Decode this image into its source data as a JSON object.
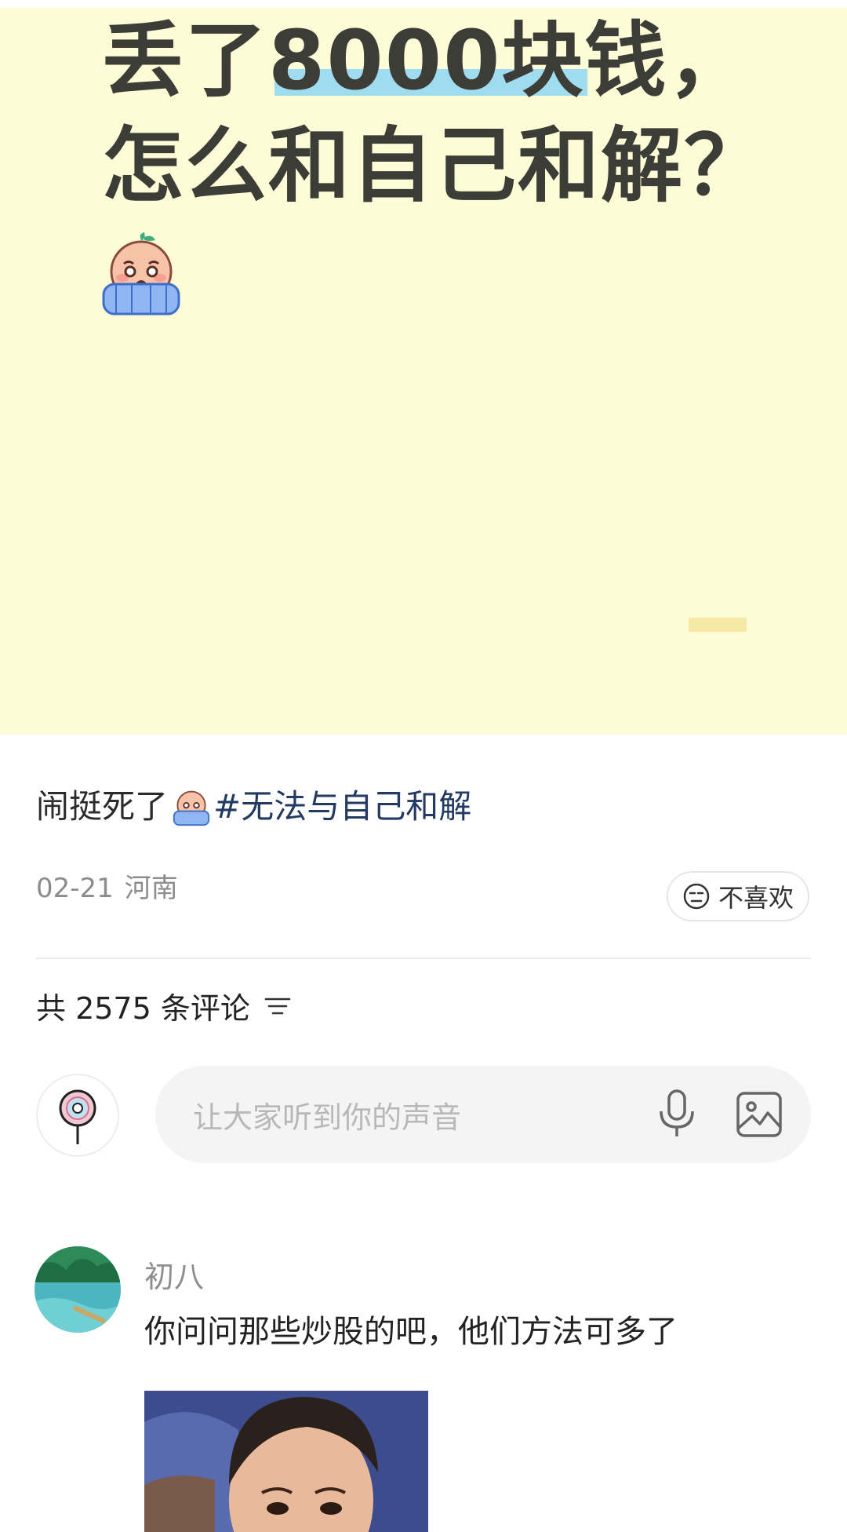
{
  "post": {
    "title_line1_before": "丢了",
    "title_line1_highlight": "8000块",
    "title_line1_after": "钱，",
    "title_line2": "怎么和自己和解？",
    "caption_text": "闹挺死了",
    "caption_tag": "#无法与自己和解",
    "date": "02-21",
    "location": "河南",
    "dislike_label": "不喜欢"
  },
  "comments_section": {
    "header": "共 2575 条评论",
    "input_placeholder": "让大家听到你的声音"
  },
  "comments": [
    {
      "name": "初八",
      "text": "你问问那些炒股的吧，他们方法可多了"
    }
  ],
  "icons": {
    "dislike": "neutral-face-icon",
    "sort": "sort-lines-icon",
    "mic": "microphone-icon",
    "image": "image-icon",
    "emoji": "crying-emoji-icon"
  },
  "colors": {
    "image_bg": "#fefcd6",
    "highlight": "#9fdcf0",
    "tag": "#233a63",
    "title": "#3d3d38"
  }
}
